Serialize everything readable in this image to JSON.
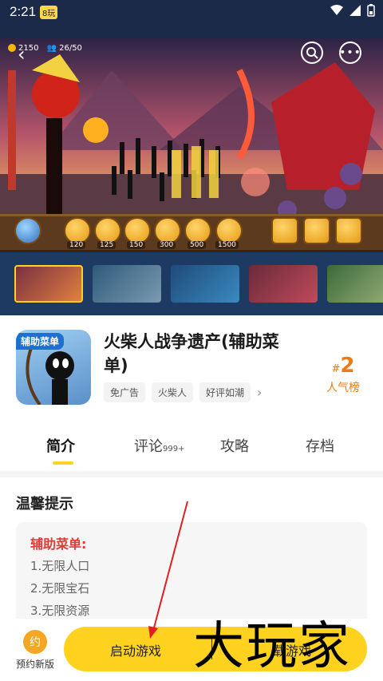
{
  "status_bar": {
    "time": "2:21",
    "badge": "8玩"
  },
  "game": {
    "coins": "2150",
    "population": "26/50",
    "unit_costs": [
      "120",
      "125",
      "150",
      "300",
      "500",
      "1500"
    ]
  },
  "app": {
    "icon_label": "辅助菜单",
    "title": "火柴人战争遗产(辅助菜单)",
    "tags": [
      "免广告",
      "火柴人",
      "好评如潮"
    ],
    "rank_hash": "#",
    "rank_number": "2",
    "rank_label": "人气榜"
  },
  "tabs": [
    {
      "label": "简介",
      "active": true
    },
    {
      "label": "评论",
      "badge": "999+"
    },
    {
      "label": "攻略"
    },
    {
      "label": "存档"
    }
  ],
  "notice": {
    "title": "温馨提示",
    "heading": "辅助菜单:",
    "items": [
      "1.无限人口",
      "2.无限宝石",
      "3.无限资源"
    ]
  },
  "bottom": {
    "reserve_icon_text": "约",
    "reserve_label": "预约新版",
    "launch_label": "启动游戏",
    "download_label": "载游戏"
  },
  "watermark": "大玩家",
  "colors": {
    "accent": "#ffd21f",
    "rank": "#f07a12",
    "notice_heading": "#e53935"
  }
}
